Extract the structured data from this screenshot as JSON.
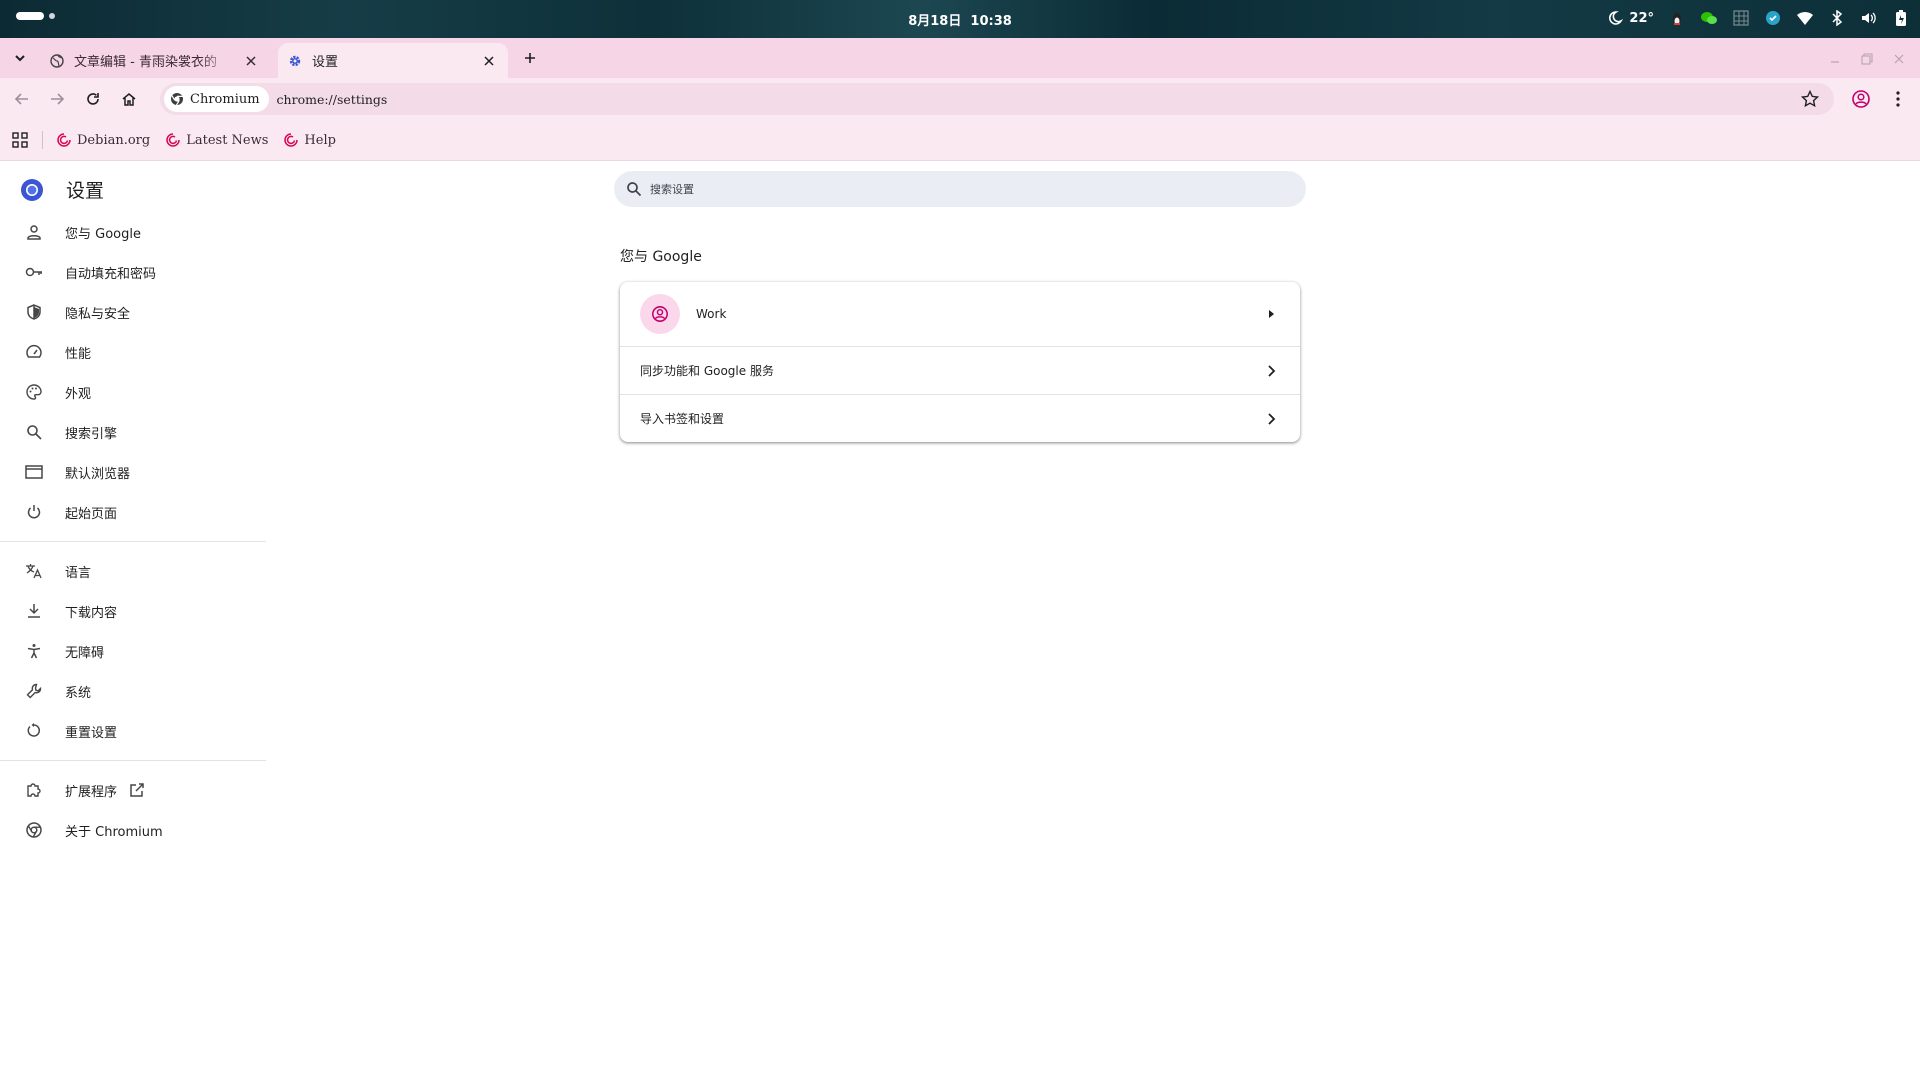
{
  "topbar": {
    "date": "8月18日",
    "time": "10:38",
    "temperature": "22°",
    "tray_icons": [
      "moon-weather-icon",
      "app-indicator-icon",
      "wechat-icon",
      "grid-app-icon",
      "vpn-icon",
      "wifi-icon",
      "bluetooth-icon",
      "volume-icon",
      "battery-icon"
    ]
  },
  "tabs": [
    {
      "title": "文章编辑 - 青雨染裳衣的",
      "icon": "globe-icon"
    },
    {
      "title": "设置",
      "icon": "gear-icon"
    }
  ],
  "toolbar": {
    "chip_label": "Chromium",
    "url": "chrome://settings"
  },
  "bookmarks": [
    {
      "label": "Debian.org"
    },
    {
      "label": "Latest News"
    },
    {
      "label": "Help"
    }
  ],
  "settings": {
    "title": "设置",
    "search_placeholder": "搜索设置",
    "menu_group1": [
      {
        "label": "您与 Google",
        "icon": "person-icon"
      },
      {
        "label": "自动填充和密码",
        "icon": "key-icon"
      },
      {
        "label": "隐私与安全",
        "icon": "shield-icon"
      },
      {
        "label": "性能",
        "icon": "speedometer-icon"
      },
      {
        "label": "外观",
        "icon": "palette-icon"
      },
      {
        "label": "搜索引擎",
        "icon": "search-icon"
      },
      {
        "label": "默认浏览器",
        "icon": "browser-window-icon"
      },
      {
        "label": "起始页面",
        "icon": "power-icon"
      }
    ],
    "menu_group2": [
      {
        "label": "语言",
        "icon": "translate-icon"
      },
      {
        "label": "下载内容",
        "icon": "download-icon"
      },
      {
        "label": "无障碍",
        "icon": "accessibility-icon"
      },
      {
        "label": "系统",
        "icon": "wrench-icon"
      },
      {
        "label": "重置设置",
        "icon": "reset-icon"
      }
    ],
    "menu_group3": [
      {
        "label": "扩展程序",
        "icon": "extension-icon"
      },
      {
        "label": "关于 Chromium",
        "icon": "chromium-icon"
      }
    ],
    "section_title": "您与 Google",
    "card_rows": [
      {
        "label": "Work"
      },
      {
        "label": "同步功能和 Google 服务"
      },
      {
        "label": "导入书签和设置"
      }
    ]
  },
  "colors": {
    "tab_strip": "#f6d5e7",
    "toolbar": "#fbe9f2",
    "accent": "#c2006b"
  }
}
